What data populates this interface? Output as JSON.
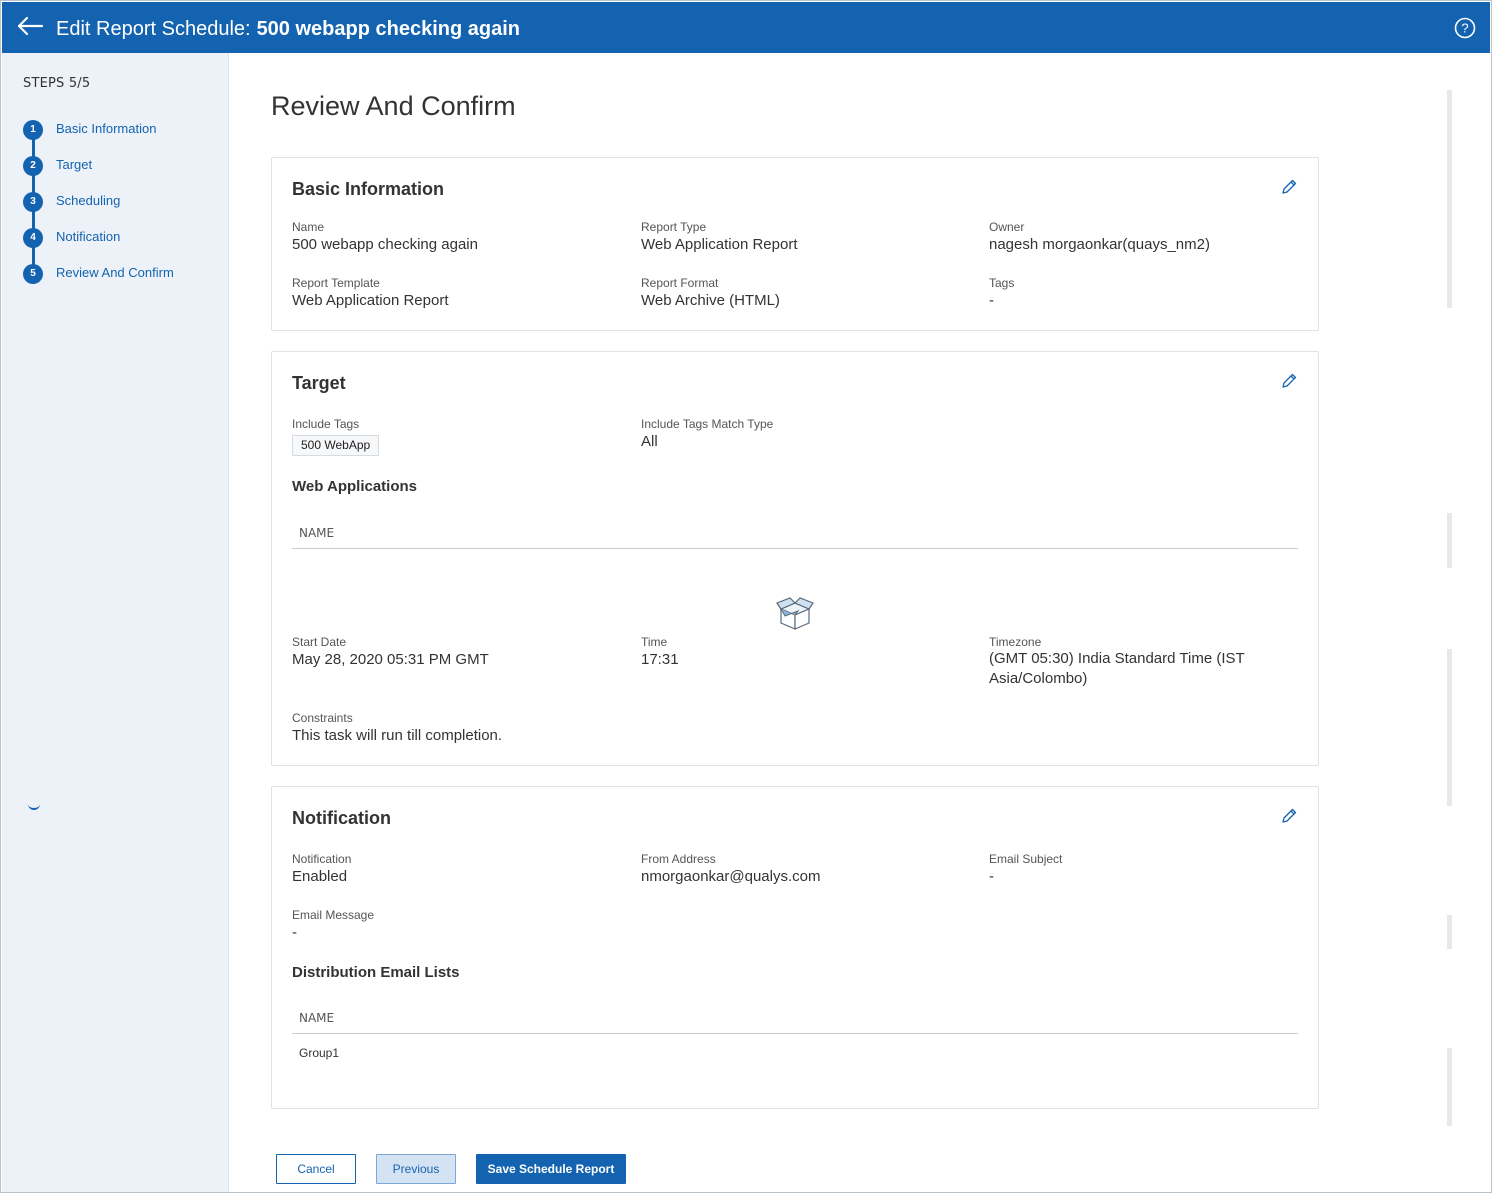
{
  "header": {
    "title_prefix": "Edit Report Schedule:",
    "schedule_name": "500 webapp checking again",
    "back_icon": "arrow-left-icon",
    "help_icon": "help-circle-icon"
  },
  "sidebar": {
    "steps_label": "STEPS 5/5",
    "steps": [
      {
        "num": "1",
        "label": "Basic Information"
      },
      {
        "num": "2",
        "label": "Target"
      },
      {
        "num": "3",
        "label": "Scheduling"
      },
      {
        "num": "4",
        "label": "Notification"
      },
      {
        "num": "5",
        "label": "Review And Confirm"
      }
    ]
  },
  "page_title": "Review And Confirm",
  "basic_info": {
    "title": "Basic Information",
    "fields": [
      {
        "label": "Name",
        "value": "500 webapp checking again"
      },
      {
        "label": "Report Type",
        "value": "Web Application Report"
      },
      {
        "label": "Owner",
        "value": "nagesh morgaonkar(quays_nm2)"
      },
      {
        "label": "Report Template",
        "value": "Web Application Report"
      },
      {
        "label": "Report Format",
        "value": "Web Archive (HTML)"
      },
      {
        "label": "Tags",
        "value": "-"
      }
    ]
  },
  "target": {
    "title": "Target",
    "include_tags_label": "Include Tags",
    "include_tag_chip": "500 WebApp",
    "match_type_label": "Include Tags Match Type",
    "match_type_value": "All",
    "web_apps_title": "Web Applications",
    "name_col": "NAME",
    "empty_icon": "empty-box-icon",
    "start_date_label": "Start Date",
    "start_date_value": "May 28, 2020 05:31 PM GMT",
    "time_label": "Time",
    "time_value": "17:31",
    "timezone_label": "Timezone",
    "timezone_value": "(GMT 05:30) India Standard Time (IST Asia/Colombo)",
    "constraints_label": "Constraints",
    "constraints_value": "This task will run till completion."
  },
  "notification": {
    "title": "Notification",
    "notification_label": "Notification",
    "notification_value": "Enabled",
    "from_label": "From Address",
    "from_value": "nmorgaonkar@qualys.com",
    "subject_label": "Email Subject",
    "subject_value": "-",
    "message_label": "Email Message",
    "message_value": "-",
    "lists_title": "Distribution Email Lists",
    "name_col": "NAME",
    "rows": [
      "Group1"
    ]
  },
  "buttons": {
    "cancel": "Cancel",
    "previous": "Previous",
    "save": "Save Schedule Report"
  },
  "colors": {
    "brand": "#1463b0",
    "sidebar_bg": "#edf2f8"
  }
}
